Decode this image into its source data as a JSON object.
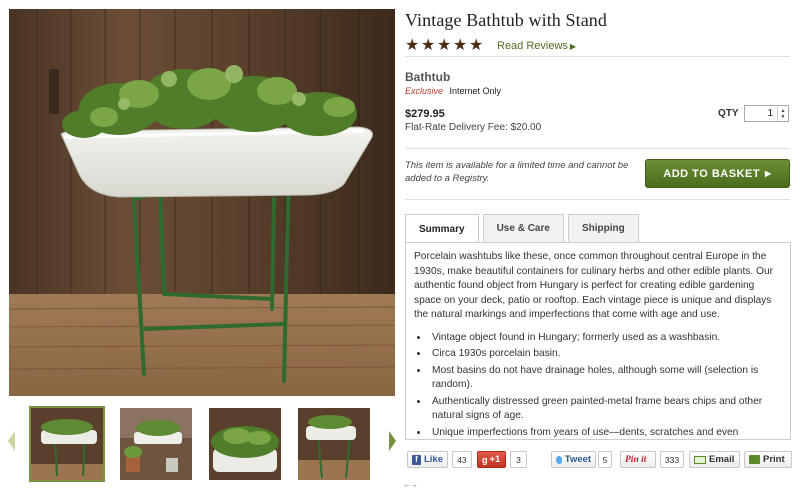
{
  "product": {
    "title": "Vintage Bathtub with Stand",
    "rating_stars": 5,
    "reviews_link": "Read Reviews",
    "name": "Bathtub",
    "badge_exclusive": "Exclusive",
    "badge_online": "Internet Only",
    "price": "$279.95",
    "delivery_fee": "Flat-Rate Delivery Fee: $20.00",
    "qty_label": "QTY",
    "qty_value": "1",
    "availability_note": "This item is available for a limited time and cannot be added to a Registry.",
    "add_to_basket": "ADD TO BASKET"
  },
  "icons": {
    "star": "star-icon",
    "caret": "caret-right-icon",
    "gallery_prev": "chevron-left-icon",
    "gallery_next": "chevron-right-icon"
  },
  "gallery": {
    "thumbnail_count": 4,
    "active_index": 0
  },
  "tabs": [
    {
      "label": "Summary",
      "active": true
    },
    {
      "label": "Use & Care",
      "active": false
    },
    {
      "label": "Shipping",
      "active": false
    }
  ],
  "summary": {
    "paragraph": "Porcelain washtubs like these, once common throughout central Europe in the 1930s, make beautiful containers for culinary herbs and other edible plants. Our authentic found object from Hungary is perfect for creating edible gardening space on your deck, patio or rooftop. Each vintage piece is unique and displays the natural markings and imperfections that come with age and use.",
    "bullets": [
      "Vintage object found in Hungary; formerly used as a washbasin.",
      "Circa 1930s porcelain basin.",
      "Most basins do not have drainage holes, although some will (selection is random).",
      "Authentically distressed green painted-metal frame bears chips and other natural signs of age.",
      "Unique imperfections from years of use—dents, scratches and even"
    ]
  },
  "social": {
    "like": "Like",
    "like_count": "43",
    "gplus": "+1",
    "gplus_count": "3",
    "tweet": "Tweet",
    "tweet_count": "5",
    "pinit": "Pin it",
    "pin_count": "333",
    "email": "Email",
    "print": "Print"
  },
  "colors": {
    "brand_green": "#5a7d27",
    "exclusive_red": "#c0392b",
    "star_brown": "#4a2c15"
  }
}
